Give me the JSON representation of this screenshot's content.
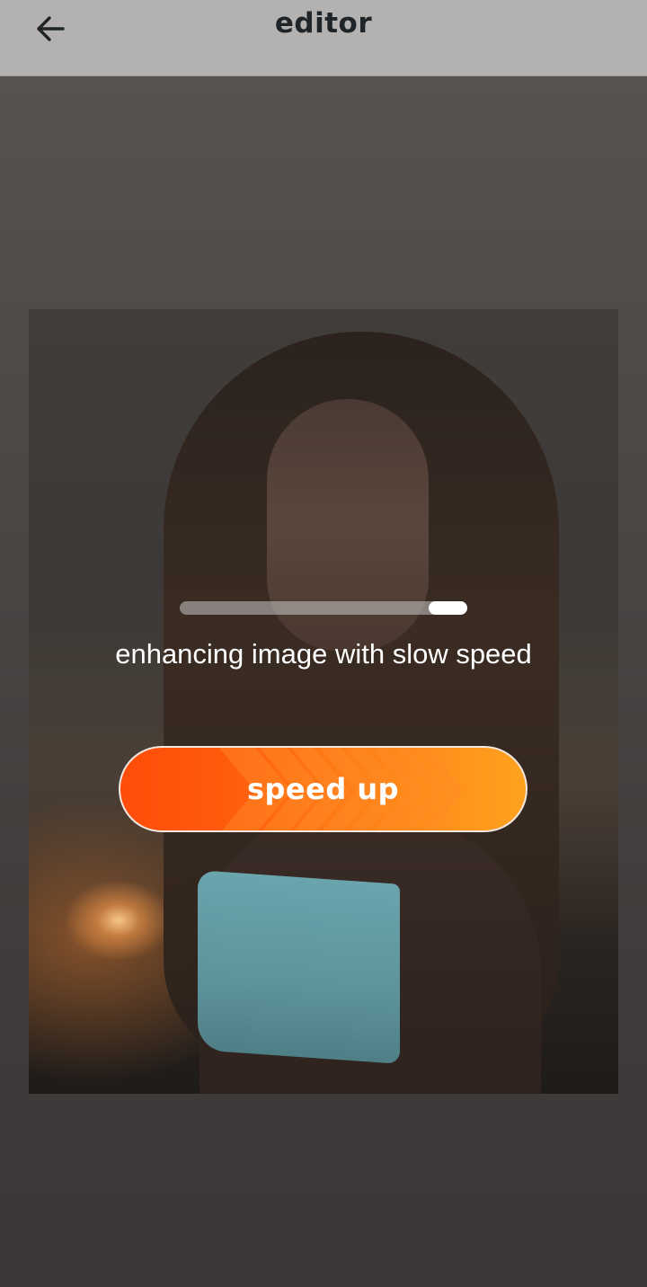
{
  "header": {
    "title": "editor",
    "back_icon": "arrow-left-icon"
  },
  "progress": {
    "value": 0.87,
    "status_text": "enhancing image with slow speed"
  },
  "action": {
    "label": "speed up",
    "icon": "chevron-stripes"
  },
  "colors": {
    "topbar": "#b3b2b1",
    "button_start": "#ff4d0a",
    "button_end": "#ffa21f",
    "title_text": "#1e2427"
  }
}
